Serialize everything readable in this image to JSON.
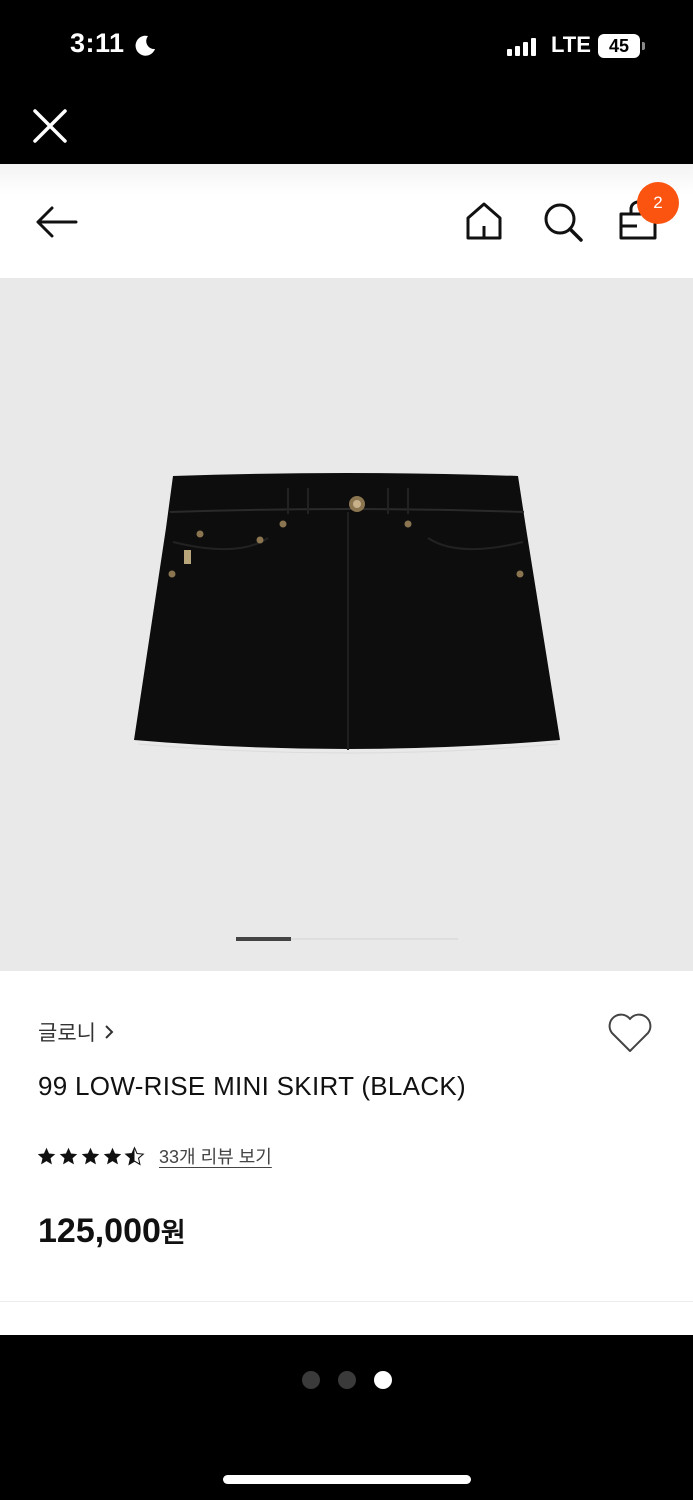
{
  "status_bar": {
    "time": "3:11",
    "network": "LTE",
    "battery": "45",
    "moon_icon": "moon-icon",
    "signal_icon": "cellular-signal-icon"
  },
  "webview": {
    "close_icon": "close-icon"
  },
  "nav": {
    "back_icon": "arrow-left-icon",
    "home_icon": "home-icon",
    "search_icon": "search-icon",
    "bag_icon": "shopping-bag-icon",
    "cart_count": "2",
    "badge_color": "#fb5410"
  },
  "gallery": {
    "image_desc": "black denim mini skirt",
    "current_page": 1,
    "background_color": "#e9e9e9"
  },
  "product": {
    "brand": "글로니",
    "name": "99 LOW-RISE MINI SKIRT (BLACK)",
    "rating": 4.5,
    "review_link": "33개 리뷰 보기",
    "price": "125,000",
    "price_unit": "원",
    "wishlist_icon": "heart-outline-icon"
  },
  "page_dots": {
    "count": 3,
    "active_index": 2
  }
}
